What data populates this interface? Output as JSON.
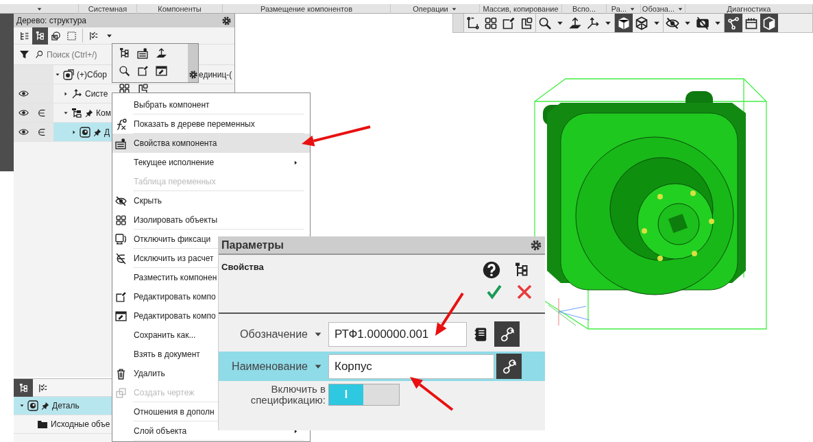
{
  "ribbon_groups": [
    {
      "caret": true
    },
    {
      "label": "Системная",
      "caret": false
    },
    {
      "label": "Компоненты",
      "caret": false
    },
    {
      "label": "Размещение компонентов",
      "caret": false
    },
    {
      "label": "Операции",
      "caret": true
    },
    {
      "label": "Массив, копирование",
      "caret": false
    },
    {
      "label": "Вспо...",
      "caret": false
    },
    {
      "label": "Ра...",
      "caret": true
    },
    {
      "label": "Обозна...",
      "caret": true
    },
    {
      "label": "Диагностика",
      "caret": false
    }
  ],
  "view_toolbar": [
    {
      "kind": "sketch-corner",
      "selected": false,
      "dropdown": false,
      "group_end": false
    },
    {
      "kind": "isolate-grid",
      "selected": false,
      "dropdown": false,
      "group_end": false
    },
    {
      "kind": "new-sketch",
      "selected": false,
      "dropdown": false,
      "group_end": false
    },
    {
      "kind": "part-lock",
      "selected": false,
      "dropdown": false,
      "group_end": true
    },
    {
      "kind": "zoom",
      "selected": false,
      "dropdown": true,
      "group_end": false
    },
    {
      "kind": "normal-arrow",
      "selected": false,
      "dropdown": false,
      "group_end": false
    },
    {
      "kind": "axes",
      "selected": false,
      "dropdown": true,
      "group_end": true
    },
    {
      "kind": "shaded-cube",
      "selected": true,
      "dropdown": false,
      "group_end": false
    },
    {
      "kind": "wire-cube",
      "selected": false,
      "dropdown": true,
      "group_end": true
    },
    {
      "kind": "eye-slash",
      "selected": false,
      "dropdown": true,
      "group_end": false
    },
    {
      "kind": "eye-hide",
      "selected": false,
      "dropdown": true,
      "group_end": true
    },
    {
      "kind": "nodes",
      "selected": true,
      "dropdown": false,
      "group_end": false
    },
    {
      "kind": "calendar-box",
      "selected": false,
      "dropdown": false,
      "group_end": false
    },
    {
      "kind": "cube-section",
      "selected": true,
      "dropdown": false,
      "group_end": false
    }
  ],
  "tree_panel": {
    "title": "Дерево: структура",
    "tools": [
      {
        "kind": "flat-tree",
        "selected": false,
        "dropdown": false
      },
      {
        "kind": "struct-tree",
        "selected": true,
        "dropdown": false
      },
      {
        "kind": "layers",
        "selected": false,
        "dropdown": false
      },
      {
        "kind": "frame-select",
        "selected": false,
        "dropdown": false
      },
      {
        "kind": "checklist",
        "selected": false,
        "dropdown": true
      }
    ],
    "search": {
      "placeholder": "Поиск (Ctrl+/)"
    },
    "rows": [
      {
        "label": "(+)Сбор",
        "tail": "единиц-(",
        "kind": "assembly",
        "expanded": true,
        "eye": false,
        "included": false,
        "pinned": false,
        "selected": false,
        "children": [
          {
            "label": "Систе",
            "kind": "axes",
            "expanded": false,
            "eye": true,
            "included": false,
            "pinned": false,
            "selected": false
          },
          {
            "label": "Ком",
            "kind": "components",
            "expanded": true,
            "eye": true,
            "included": true,
            "pinned": true,
            "selected": false,
            "children": [
              {
                "label": "Д",
                "kind": "part",
                "expanded": false,
                "eye": true,
                "included": true,
                "pinned": true,
                "selected": true
              }
            ]
          }
        ]
      }
    ]
  },
  "bottom_panel": {
    "tabs": [
      {
        "kind": "struct-tree",
        "selected": true
      },
      {
        "kind": "checklist",
        "selected": false
      }
    ],
    "rows": [
      {
        "label": "Деталь",
        "kind": "part",
        "expanded": true,
        "pinned": true,
        "selected": true,
        "children": [
          {
            "label": "Исходные объе",
            "kind": "folder",
            "selected": false
          }
        ]
      }
    ]
  },
  "context_menu": [
    {
      "label": "Выбрать компонент",
      "kind": "text",
      "disabled": false,
      "selected": false,
      "submenu": false,
      "divider": true
    },
    {
      "label": "Показать в дереве переменных",
      "kind": "fx",
      "disabled": false,
      "selected": false,
      "submenu": false,
      "divider": true
    },
    {
      "label": "Свойства компонента",
      "kind": "props",
      "disabled": false,
      "selected": true,
      "submenu": false,
      "divider": true
    },
    {
      "label": "Текущее исполнение",
      "kind": "text",
      "disabled": false,
      "selected": false,
      "submenu": true,
      "divider": false
    },
    {
      "label": "Таблица переменных",
      "kind": "text",
      "disabled": true,
      "selected": false,
      "submenu": false,
      "divider": true
    },
    {
      "label": "Скрыть",
      "kind": "eye-slash",
      "disabled": false,
      "selected": false,
      "submenu": false,
      "divider": false
    },
    {
      "label": "Изолировать объекты",
      "kind": "isolate-grid",
      "disabled": false,
      "selected": false,
      "submenu": false,
      "divider": true
    },
    {
      "label": "Отключить фиксаци",
      "kind": "unfix",
      "disabled": false,
      "selected": false,
      "submenu": false,
      "divider": true
    },
    {
      "label": "Исключить из расчет",
      "kind": "exclude",
      "disabled": false,
      "selected": false,
      "submenu": false,
      "divider": true
    },
    {
      "label": "Разместить компонен",
      "kind": "text",
      "disabled": false,
      "selected": false,
      "submenu": false,
      "divider": false
    },
    {
      "label": "Редактировать компо",
      "kind": "new-sketch",
      "disabled": false,
      "selected": false,
      "submenu": false,
      "divider": false
    },
    {
      "label": "Редактировать компо",
      "kind": "edit-pencil",
      "disabled": false,
      "selected": false,
      "submenu": false,
      "divider": false
    },
    {
      "label": "Сохранить как...",
      "kind": "text",
      "disabled": false,
      "selected": false,
      "submenu": false,
      "divider": false
    },
    {
      "label": "Взять в документ",
      "kind": "text",
      "disabled": false,
      "selected": false,
      "submenu": false,
      "divider": false
    },
    {
      "label": "Удалить",
      "kind": "trash",
      "disabled": false,
      "selected": false,
      "submenu": false,
      "divider": false
    },
    {
      "label": "Создать чертеж",
      "kind": "drawing",
      "disabled": true,
      "selected": false,
      "submenu": false,
      "divider": true
    },
    {
      "label": "Отношения в дополн",
      "kind": "text",
      "disabled": false,
      "selected": false,
      "submenu": false,
      "divider": true
    },
    {
      "label": "Слой объекта",
      "kind": "text",
      "disabled": false,
      "selected": false,
      "submenu": true,
      "divider": true
    }
  ],
  "dialog": {
    "title": "Параметры",
    "section": "Свойства",
    "fields": [
      {
        "label": "Обозначение",
        "value": "РТФ1.000000.001",
        "selected": false,
        "notebook": true
      },
      {
        "label": "Наименование",
        "value": "Корпус",
        "selected": true,
        "notebook": false
      }
    ],
    "toggle": {
      "label": "Включить в спецификацию:",
      "on": true,
      "on_label": "I"
    }
  }
}
